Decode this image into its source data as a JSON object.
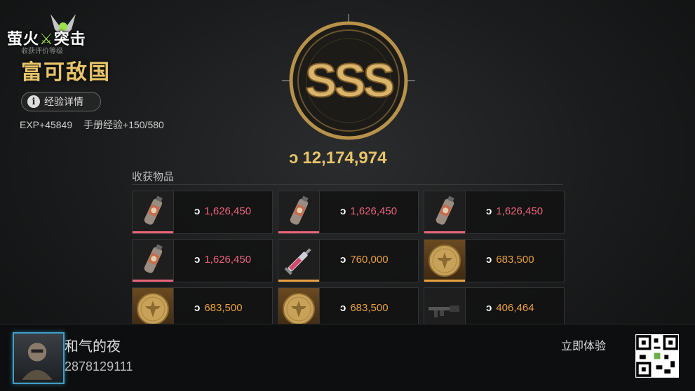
{
  "logo": {
    "part1": "萤火",
    "part2": "突击"
  },
  "header": {
    "small_label": "收获评价等级",
    "rank_title": "富可敌国",
    "exp_button_label": "经验详情",
    "exp_value": "EXP+45849",
    "manual_exp": "手册经验+150/580"
  },
  "rating": {
    "grade": "SSS",
    "total": "12,174,974"
  },
  "loot": {
    "title": "收获物品",
    "items": [
      {
        "icon": "spray-can-icon",
        "price": "1,626,450",
        "color": "#e8647a",
        "bar": "#e8647a",
        "gold": false
      },
      {
        "icon": "spray-can-icon",
        "price": "1,626,450",
        "color": "#e8647a",
        "bar": "#e8647a",
        "gold": false
      },
      {
        "icon": "spray-can-icon",
        "price": "1,626,450",
        "color": "#e8647a",
        "bar": "#e8647a",
        "gold": false
      },
      {
        "icon": "spray-can-icon",
        "price": "1,626,450",
        "color": "#e8647a",
        "bar": "#e8647a",
        "gold": false
      },
      {
        "icon": "syringe-icon",
        "price": "760,000",
        "color": "#e8a040",
        "bar": "#e8a040",
        "gold": false
      },
      {
        "icon": "gold-coin-icon",
        "price": "683,500",
        "color": "#e8a040",
        "bar": "#e8a040",
        "gold": true
      },
      {
        "icon": "gold-coin-icon",
        "price": "683,500",
        "color": "#e8a040",
        "bar": "#e8a040",
        "gold": true
      },
      {
        "icon": "gold-coin-icon",
        "price": "683,500",
        "color": "#e8a040",
        "bar": "#e8a040",
        "gold": true
      },
      {
        "icon": "rifle-icon",
        "price": "406,464",
        "color": "#e8a040",
        "bar": "#e8a040",
        "gold": false
      }
    ]
  },
  "footer": {
    "username": "和气的夜",
    "user_id": "2878129111",
    "cta": "立即体验"
  }
}
